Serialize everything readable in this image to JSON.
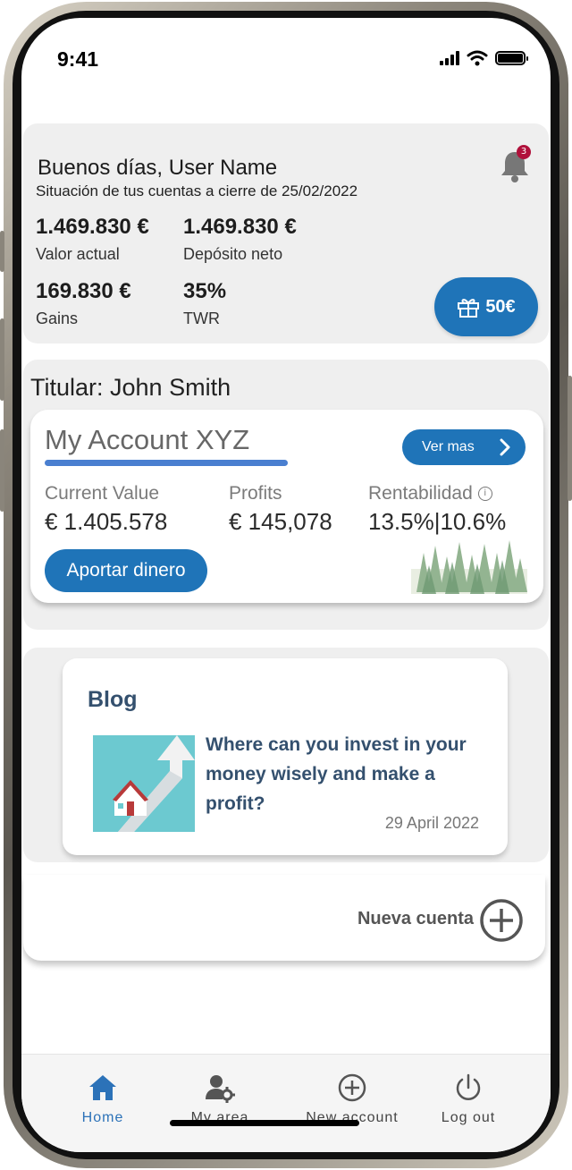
{
  "status_bar": {
    "time": "9:41"
  },
  "summary": {
    "greeting": "Buenos días, User Name",
    "subtitle": "Situación de tus cuentas a cierre de 25/02/2022",
    "notification_count": "3",
    "metrics": [
      {
        "value": "1.469.830 €",
        "label": "Valor actual"
      },
      {
        "value": "1.469.830 €",
        "label": "Depósito neto"
      },
      {
        "value": "169.830 €",
        "label": "Gains"
      },
      {
        "value": "35%",
        "label": "TWR"
      }
    ],
    "gift_label": "50€"
  },
  "account": {
    "holder": "Titular: John Smith",
    "name": "My Account XYZ",
    "ver_mas": "Ver mas",
    "columns": [
      {
        "label": "Current Value",
        "value": "€ 1.405.578"
      },
      {
        "label": "Profits",
        "value": "€ 145,078"
      },
      {
        "label": "Rentabilidad",
        "value": "13.5%|10.6%"
      }
    ],
    "aportar_label": "Aportar dinero"
  },
  "blog": {
    "title": "Blog",
    "headline": "Where can you invest in your money wisely and make a profit?",
    "date": "29 April 2022"
  },
  "new_account": {
    "label": "Nueva cuenta"
  },
  "bottom_nav": {
    "items": [
      {
        "label": "Home",
        "icon": "home-icon",
        "active": true
      },
      {
        "label": "My area",
        "icon": "user-settings-icon",
        "active": false
      },
      {
        "label": "New account",
        "icon": "plus-circle-icon",
        "active": false
      },
      {
        "label": "Log out",
        "icon": "power-icon",
        "active": false
      }
    ]
  },
  "colors": {
    "primary": "#1f74b8",
    "accent_underline": "#4a7fd0",
    "badge": "#b0113b",
    "blog_text": "#34506e"
  }
}
